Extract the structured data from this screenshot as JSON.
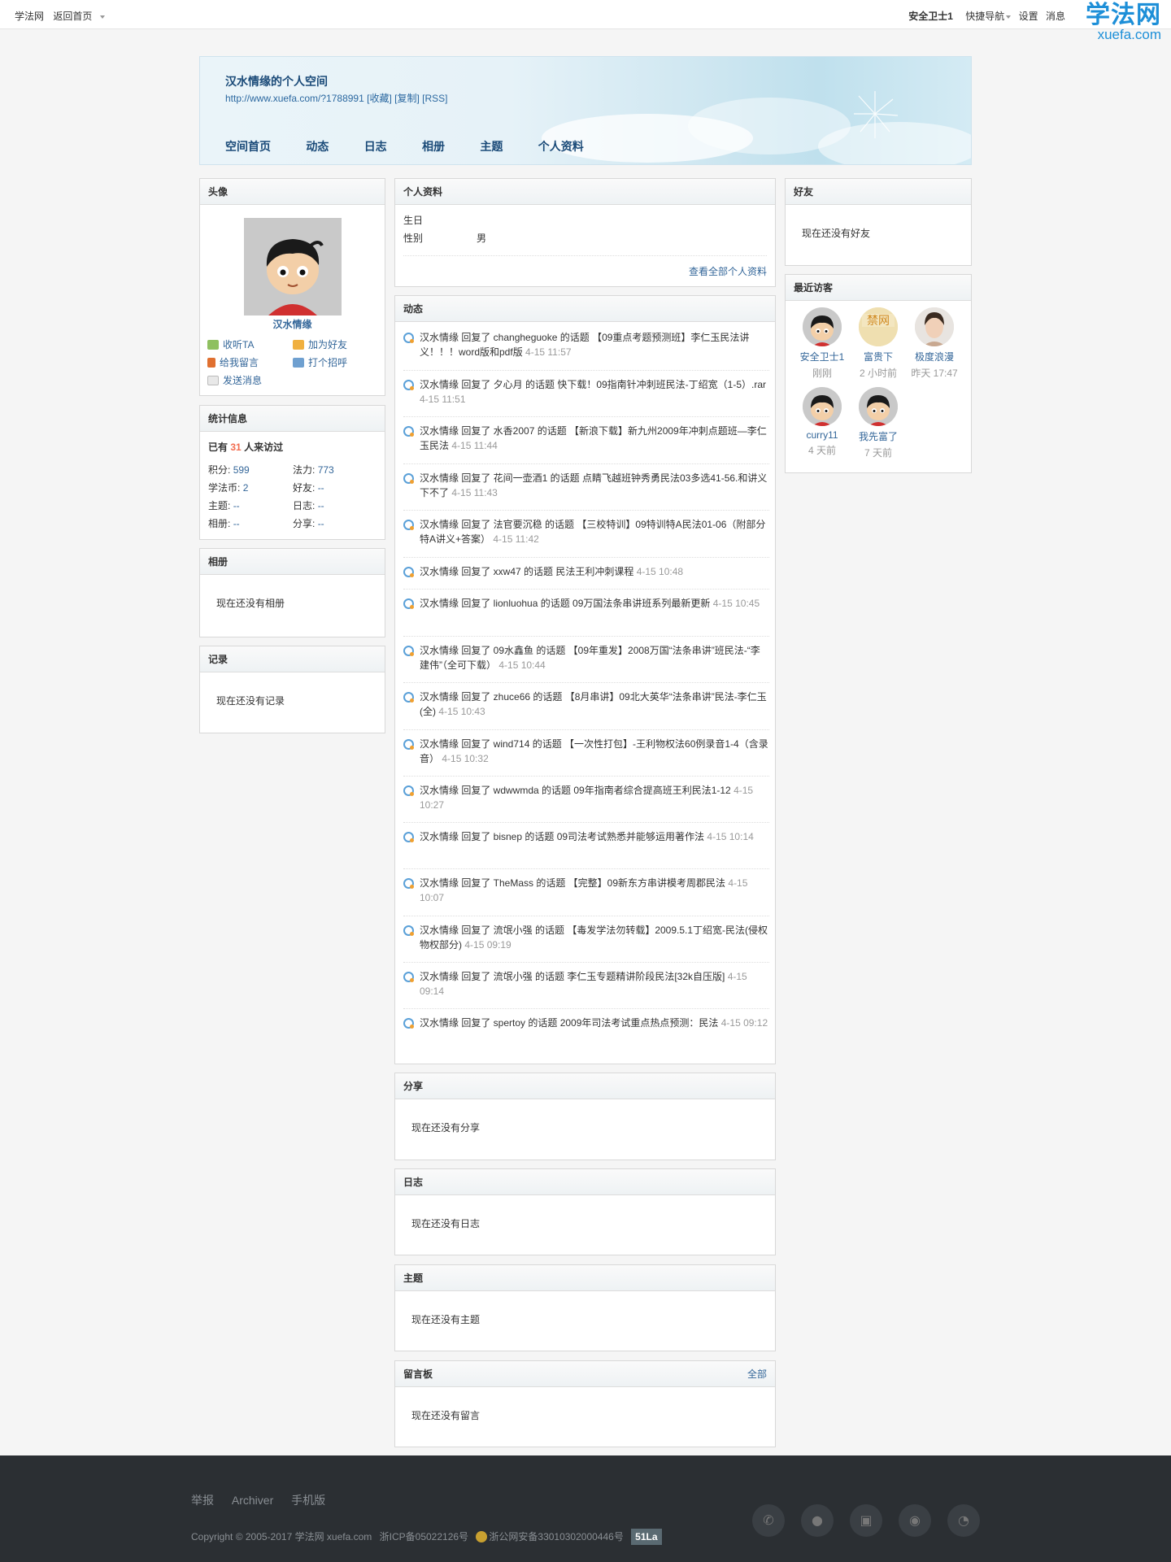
{
  "topbar": {
    "site": "学法网",
    "home": "返回首页",
    "user": "安全卫士1",
    "quicknav": "快捷导航",
    "settings": "设置",
    "messages": "消息"
  },
  "watermark": {
    "big": "学法网",
    "small": "xuefa.com"
  },
  "space": {
    "title": "汉水情缘的个人空间",
    "url": "http://www.xuefa.com/?1788991 [收藏] [复制] [RSS]",
    "nav": [
      "空间首页",
      "动态",
      "日志",
      "相册",
      "主题",
      "个人资料"
    ]
  },
  "avatar_box": {
    "title": "头像",
    "name": "汉水情缘",
    "actions": [
      "收听TA",
      "加为好友",
      "给我留言",
      "打个招呼",
      "发送消息"
    ]
  },
  "stats": {
    "title": "统计信息",
    "visit_prefix": "已有",
    "visit_count": "31",
    "visit_suffix": "人来访过",
    "items": [
      {
        "label": "积分:",
        "value": "599"
      },
      {
        "label": "法力:",
        "value": "773"
      },
      {
        "label": "学法币:",
        "value": "2"
      },
      {
        "label": "好友:",
        "value": "--"
      },
      {
        "label": "主题:",
        "value": "--"
      },
      {
        "label": "日志:",
        "value": "--"
      },
      {
        "label": "相册:",
        "value": "--"
      },
      {
        "label": "分享:",
        "value": "--"
      }
    ]
  },
  "album": {
    "title": "相册",
    "empty": "现在还没有相册"
  },
  "record": {
    "title": "记录",
    "empty": "现在还没有记录"
  },
  "profile": {
    "title": "个人资料",
    "birthday_label": "生日",
    "gender_label": "性别",
    "gender_value": "男",
    "more": "查看全部个人资料"
  },
  "feed": {
    "title": "动态",
    "items": [
      {
        "text": "汉水情缘 回复了 changheguoke 的话题 【09重点考题预测班】李仁玉民法讲义！！！word版和pdf版",
        "time": "4-15 11:57"
      },
      {
        "text": "汉水情缘 回复了 夕心月 的话题 快下载！09指南针冲刺班民法-丁绍宽（1-5）.rar",
        "time": "4-15 11:51"
      },
      {
        "text": "汉水情缘 回复了 水香2007 的话题 【新浪下载】新九州2009年冲刺点题班—李仁玉民法",
        "time": "4-15 11:44"
      },
      {
        "text": "汉水情缘 回复了 花间一壶酒1 的话题 点睛飞越班钟秀勇民法03多选41-56.和讲义下不了",
        "time": "4-15 11:43"
      },
      {
        "text": "汉水情缘 回复了 法官要沉稳 的话题 【三校特训】09特训特A民法01-06（附部分特A讲义+答案）",
        "time": "4-15 11:42"
      },
      {
        "text": "汉水情缘 回复了 xxw47 的话题 民法王利冲刺课程",
        "time": "4-15 10:48"
      },
      {
        "text": "汉水情缘 回复了 lionluohua 的话题 09万国法条串讲班系列最新更新",
        "time": "4-15 10:45"
      },
      {
        "text": "汉水情缘 回复了 09水鑫鱼 的话题 【09年重发】2008万国“法条串讲”班民法-“李建伟”（全可下载）",
        "time": "4-15 10:44"
      },
      {
        "text": "汉水情缘 回复了 zhuce66 的话题 【8月串讲】09北大英华“法条串讲”民法-李仁玉(全)",
        "time": "4-15 10:43"
      },
      {
        "text": "汉水情缘 回复了 wind714 的话题 【一次性打包】-王利物权法60例录音1-4（含录音）",
        "time": "4-15 10:32"
      },
      {
        "text": "汉水情缘 回复了 wdwwmda 的话题 09年指南者综合提高班王利民法1-12",
        "time": "4-15 10:27"
      },
      {
        "text": "汉水情缘 回复了 bisnep 的话题 09司法考试熟悉并能够运用著作法",
        "time": "4-15 10:14"
      },
      {
        "text": "汉水情缘 回复了 TheMass 的话题 【完整】09新东方串讲模考周郡民法",
        "time": "4-15 10:07"
      },
      {
        "text": "汉水情缘 回复了 流氓小强 的话题 【毒发学法勿转载】2009.5.1丁绍宽-民法(侵权物权部分)",
        "time": "4-15 09:19"
      },
      {
        "text": "汉水情缘 回复了 流氓小强 的话题 李仁玉专题精讲阶段民法[32k自压版]",
        "time": "4-15 09:14"
      },
      {
        "text": "汉水情缘 回复了 spertoy 的话题 2009年司法考试重点热点预测：民法",
        "time": "4-15 09:12"
      }
    ]
  },
  "share": {
    "title": "分享",
    "empty": "现在还没有分享"
  },
  "blog": {
    "title": "日志",
    "empty": "现在还没有日志"
  },
  "topic": {
    "title": "主题",
    "empty": "现在还没有主题"
  },
  "guestbook": {
    "title": "留言板",
    "more": "全部",
    "empty": "现在还没有留言"
  },
  "friends": {
    "title": "好友",
    "empty": "现在还没有好友"
  },
  "visitors": {
    "title": "最近访客",
    "items": [
      {
        "name": "安全卫士1",
        "time": "刚刚"
      },
      {
        "name": "富贵下",
        "time": "2 小时前"
      },
      {
        "name": "极度浪漫",
        "time": "昨天 17:47"
      },
      {
        "name": "curry11",
        "time": "4 天前"
      },
      {
        "name": "我先富了",
        "time": "7 天前"
      }
    ]
  },
  "footer": {
    "links": [
      "举报",
      "Archiver",
      "手机版"
    ],
    "copyright": "Copyright © 2005-2017 学法网 xuefa.com",
    "icp": "浙ICP备05022126号",
    "police": "浙公网安备33010302000446号",
    "badge": "51La"
  },
  "colors": {
    "link": "#336699",
    "accent": "#f26c4f",
    "footer_bg": "#2b2f33"
  }
}
